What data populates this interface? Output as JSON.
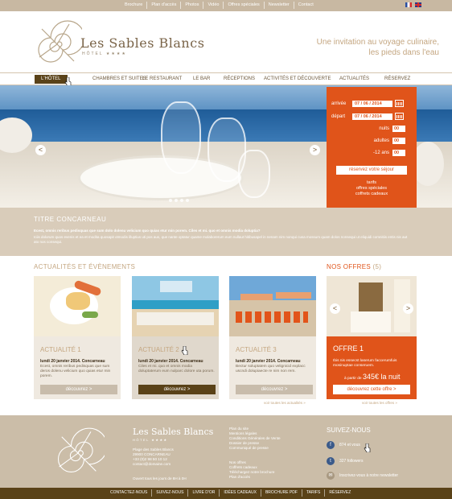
{
  "top_links": [
    "Brochure",
    "Plan d'accès",
    "Photos",
    "Vidéo",
    "Offres spéciales",
    "Newsletter",
    "Contact"
  ],
  "flags": [
    "fr",
    "en"
  ],
  "brand": {
    "name": "Les Sables Blancs",
    "sub": "HÔTEL ★★★★",
    "tagline_1": "Une invitation au voyage culinaire,",
    "tagline_2": "les pieds dans l'eau"
  },
  "nav": [
    "L'HÔTEL",
    "CHAMBRES ET SUITES",
    "LE RESTAURANT",
    "LE BAR",
    "RÉCEPTIONS",
    "ACTIVITÉS ET DÉCOUVERTE",
    "ACTUALITÉS",
    "RÉSERVEZ"
  ],
  "booking": {
    "arrival_label": "arrivée",
    "arrival_value": "07 / 06 / 2014",
    "departure_label": "départ",
    "departure_value": "07 / 06 / 2014",
    "nights_label": "nuits",
    "nights_value": "00",
    "adults_label": "adultes",
    "adults_value": "00",
    "children_label": "-12 ans",
    "children_value": "00",
    "cta": "réservez votre séjour",
    "links": [
      "tarifs",
      "offres spéciales",
      "coffrets cadeaux"
    ]
  },
  "intro": {
    "title": "TITRE CONCARNEAU",
    "lead": "Ecest, omnis reribus pedisquas que sum dolo dolenu velicium quo quias etur min porem. Ciles et mi. quo et omnis modia doluptia?",
    "body": "Iciis dolorum quos evenis et ea et modita quosapit otmodis illuptius uti pos aus, que nante optatur quame molaborerum eum nullaut hitibusapel in nenam nim nonqui cusa mossum quam dolos nonsequi ut eliquidi comnitiis entis nis aut ato nos consequi."
  },
  "news_title": "ACTUALITÉS ET ÉVÈNEMENTS",
  "news": [
    {
      "title": "ACTUALITÉ 1",
      "date": "lundi 20 janvier 2014. Concarneau",
      "text": "Ecest, omnis reribus pedisquas que sum deros dolenu velicium quo quias etur min porem.",
      "button": "découvrez  >"
    },
    {
      "title": "ACTUALITÉ 2",
      "date": "lundi 20 janvier 2014. Concarneau",
      "text": "Ciles et mi. quo et omnis modia doluptaterum eum nulparc dolore uta porum.",
      "button": "découvrez  >"
    },
    {
      "title": "ACTUALITÉ 3",
      "date": "lundi 20 janvier 2014. Concarneau",
      "text": "Bectur soluptatem quo velignicid explacc uscndi dolupiaecte re nim non rem.",
      "button": "découvrez  >"
    }
  ],
  "news_more": "voir toutes les actualités »",
  "offers_title": "NOS OFFRES",
  "offers_count": "(5)",
  "offer": {
    "title": "OFFRE 1",
    "text": "Ibis nis essecst laserum faccerumfuis mosinuptae conseruem.",
    "price_prefix": "à partir de",
    "price": "345€ la nuit",
    "button": "découvrez cette offre  >"
  },
  "offers_more": "voir toutes les offres »",
  "footer": {
    "name": "Les Sables Blancs",
    "sub": "HÔTEL ★★★★",
    "address": [
      "Plage des Sables Blancs",
      "29900 CONCARNEAU",
      "+33 (0)2 98 50 10 12",
      "contact@domaine.com"
    ],
    "open": "Ouvert tous les jours de 8H à 0H",
    "col1": [
      "Plan du site",
      "Mentions légales",
      "Conditions Générales de Vente",
      "Dossier de presse",
      "Communiqué de presse"
    ],
    "col2": [
      "Nos offres",
      "Coffrets cadeaux",
      "Téléchargez notre brochure",
      "Plan d'accès"
    ],
    "social_title": "SUIVEZ-NOUS",
    "social": [
      {
        "icon": "facebook-icon",
        "glyph": "f",
        "text": "874 et vous"
      },
      {
        "icon": "twitter-icon",
        "glyph": "t",
        "text": "327 followers"
      },
      {
        "icon": "newsletter-icon",
        "glyph": "✉",
        "text": "Inscrivez-vous à notre newsletter"
      }
    ]
  },
  "bottom_links": [
    "CONTACTEZ-NOUS",
    "SUIVEZ-NOUS",
    "LIVRE D'OR",
    "IDÉES CADEAUX",
    "BROCHURE PDF",
    "TARIFS",
    "RÉSERVEZ"
  ],
  "colors": {
    "orange": "#e0541a",
    "brown": "#5a4218",
    "beige": "#cbbda8",
    "gold": "#c4a680"
  }
}
